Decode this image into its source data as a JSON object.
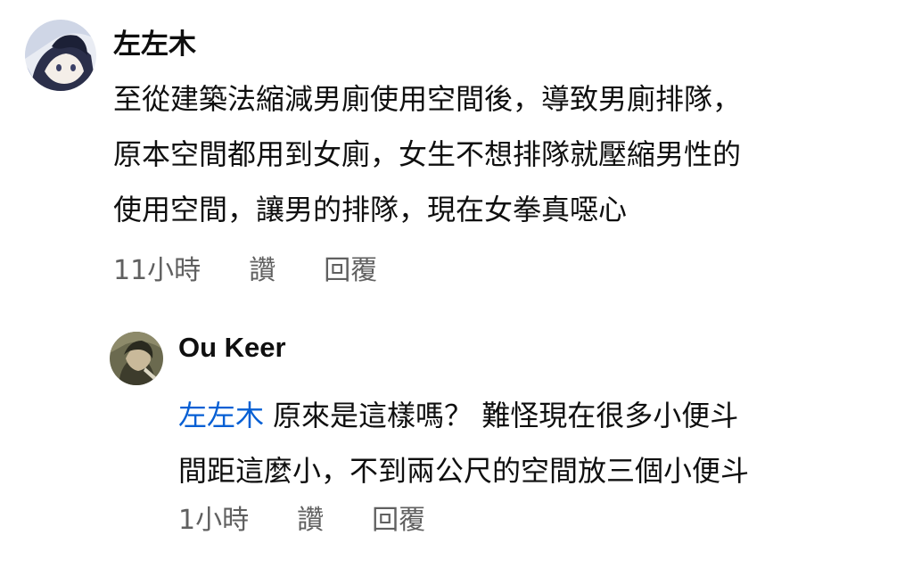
{
  "comment": {
    "author": "左左木",
    "avatar_icon": "anime-character-avatar-icon",
    "body_lines": [
      "至從建築法縮減男廁使用空間後，導致男廁排隊，",
      "原本空間都用到女廁，女生不想排隊就壓縮男性的",
      "使用空間，讓男的排隊，現在女拳真噁心"
    ],
    "time": "11小時",
    "like_label": "讚",
    "reply_label": "回覆"
  },
  "reply": {
    "author": "Ou Keer",
    "avatar_icon": "character-portrait-avatar-icon",
    "mention": "左左木",
    "body_line_1": "原來是這樣嗎？ 難怪現在很多小便斗",
    "body_line_2": "間距這麼小，不到兩公尺的空間放三個小便斗",
    "time": "1小時",
    "like_label": "讚",
    "reply_label": "回覆"
  },
  "colors": {
    "mention": "#065fd4",
    "secondary_text": "#606060",
    "primary_text": "#0f0f0f"
  }
}
